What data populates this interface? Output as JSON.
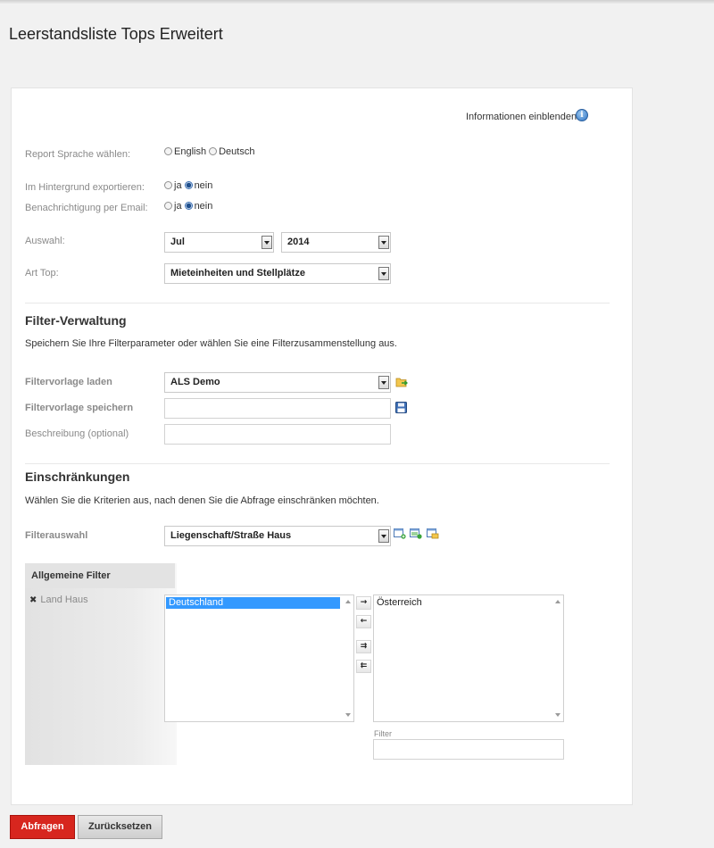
{
  "page": {
    "title": "Leerstandsliste Tops Erweitert"
  },
  "info": {
    "label": "Informationen einblenden",
    "icon": "info-icon"
  },
  "form": {
    "language": {
      "label": "Report Sprache wählen:",
      "options": [
        "English",
        "Deutsch"
      ]
    },
    "background_export": {
      "label": "Im Hintergrund exportieren:",
      "yes": "ja",
      "no": "nein"
    },
    "email_notify": {
      "label": "Benachrichtigung per Email:",
      "yes": "ja",
      "no": "nein"
    },
    "selection": {
      "label": "Auswahl:",
      "month": "Jul",
      "year": "2014"
    },
    "art_top": {
      "label": "Art Top:",
      "value": "Mieteinheiten und Stellplätze"
    }
  },
  "filter_management": {
    "title": "Filter-Verwaltung",
    "description": "Speichern Sie Ihre Filterparameter oder wählen Sie eine Filterzusammenstellung aus.",
    "load": {
      "label": "Filtervorlage laden",
      "value": "ALS Demo"
    },
    "save": {
      "label": "Filtervorlage speichern",
      "value": ""
    },
    "description_field": {
      "label": "Beschreibung (optional)",
      "value": ""
    }
  },
  "restrictions": {
    "title": "Einschränkungen",
    "description": "Wählen Sie die Kriterien aus, nach denen Sie die Abfrage einschränken möchten.",
    "filter_select": {
      "label": "Filterauswahl",
      "value": "Liegenschaft/Straße Haus"
    }
  },
  "general_filter": {
    "heading": "Allgemeine Filter",
    "items": [
      {
        "label": "Land Haus"
      }
    ],
    "available": [
      "Deutschland"
    ],
    "selected": [
      "Österreich"
    ],
    "filter_label": "Filter",
    "filter_value": "",
    "move_buttons": {
      "add": "→",
      "remove": "←",
      "add_all": "⇉",
      "remove_all": "⇇"
    }
  },
  "actions": {
    "submit": "Abfragen",
    "reset": "Zurücksetzen"
  },
  "colors": {
    "primary": "#d7261e",
    "selection": "#3399ff",
    "info": "#2f74c4"
  }
}
